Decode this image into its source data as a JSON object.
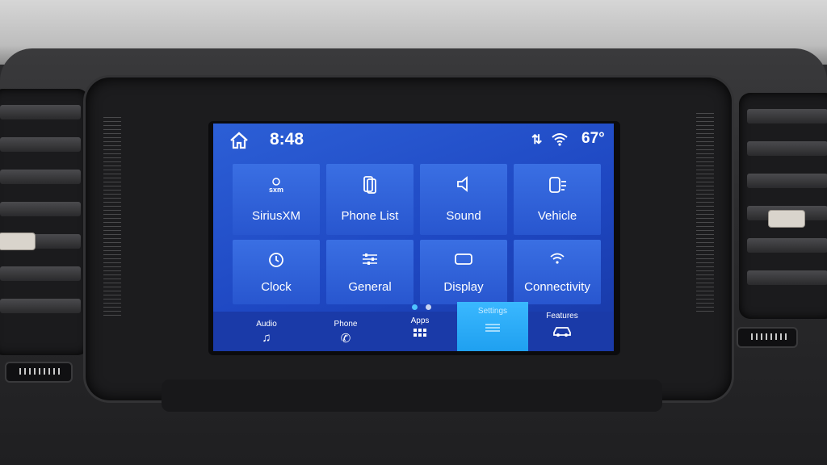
{
  "status_bar": {
    "time": "8:48",
    "temperature": "67°",
    "icons": [
      "home-icon",
      "sync-arrows-icon",
      "wifi-icon"
    ]
  },
  "tiles": [
    {
      "label": "SiriusXM",
      "icon": "siriusxm-icon"
    },
    {
      "label": "Phone List",
      "icon": "phone-list-icon"
    },
    {
      "label": "Sound",
      "icon": "speaker-icon"
    },
    {
      "label": "Vehicle",
      "icon": "vehicle-icon"
    },
    {
      "label": "Clock",
      "icon": "clock-icon"
    },
    {
      "label": "General",
      "icon": "sliders-icon"
    },
    {
      "label": "Display",
      "icon": "display-icon"
    },
    {
      "label": "Connectivity",
      "icon": "wifi-icon"
    }
  ],
  "pagination": {
    "pages": 2,
    "current": 1
  },
  "nav": [
    {
      "label": "Audio",
      "icon": "music-note-icon"
    },
    {
      "label": "Phone",
      "icon": "phone-icon"
    },
    {
      "label": "Apps",
      "icon": "apps-grid-icon"
    },
    {
      "label": "Settings",
      "icon": "settings-sliders-icon",
      "active": true
    },
    {
      "label": "Features",
      "icon": "car-icon"
    }
  ],
  "colors": {
    "screen_bg": "#2350cc",
    "tile_bg": "#3166dd",
    "nav_bg": "#1a3aa8",
    "active_tab": "#2aaaf8",
    "dot_active": "#4fc3ff",
    "dot_inactive": "#c8d4f0"
  }
}
